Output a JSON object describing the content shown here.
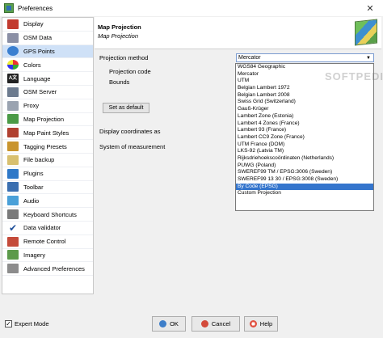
{
  "window": {
    "title": "Preferences",
    "close_glyph": "✕"
  },
  "sidebar": {
    "items": [
      {
        "label": "Display",
        "icon": "display-icon"
      },
      {
        "label": "OSM Data",
        "icon": "osm-data-icon"
      },
      {
        "label": "GPS Points",
        "icon": "gps-points-icon",
        "selected": true
      },
      {
        "label": "Colors",
        "icon": "colors-icon"
      },
      {
        "label": "Language",
        "icon": "language-icon"
      },
      {
        "label": "OSM Server",
        "icon": "osm-server-icon"
      },
      {
        "label": "Proxy",
        "icon": "proxy-icon"
      },
      {
        "label": "Map Projection",
        "icon": "map-projection-icon"
      },
      {
        "label": "Map Paint Styles",
        "icon": "paint-styles-icon"
      },
      {
        "label": "Tagging Presets",
        "icon": "tagging-presets-icon"
      },
      {
        "label": "File backup",
        "icon": "file-backup-icon"
      },
      {
        "label": "Plugins",
        "icon": "plugins-icon"
      },
      {
        "label": "Toolbar",
        "icon": "toolbar-icon"
      },
      {
        "label": "Audio",
        "icon": "audio-icon"
      },
      {
        "label": "Keyboard Shortcuts",
        "icon": "keyboard-icon"
      },
      {
        "label": "Data validator",
        "icon": "validator-check-icon"
      },
      {
        "label": "Remote Control",
        "icon": "remote-control-icon"
      },
      {
        "label": "Imagery",
        "icon": "imagery-icon"
      },
      {
        "label": "Advanced Preferences",
        "icon": "advanced-preferences-icon"
      }
    ]
  },
  "panel": {
    "title": "Map Projection",
    "subtitle": "Map Projection",
    "projection_method_label": "Projection method",
    "projection_code_label": "Projection code",
    "bounds_label": "Bounds",
    "set_default_label": "Set as default",
    "coords_label": "Display coordinates as",
    "measurement_label": "System of measurement",
    "combo_value": "Mercator",
    "watermark": "SOFTPEDIA",
    "dropdown_options": [
      "WGS84 Geographic",
      "Mercator",
      "UTM",
      "Belgian Lambert 1972",
      "Belgian Lambert 2008",
      "Swiss Grid (Switzerland)",
      "Gauß-Krüger",
      "Lambert Zone (Estonia)",
      "Lambert 4 Zones (France)",
      "Lambert 93 (France)",
      "Lambert CC9 Zone (France)",
      "UTM France (DOM)",
      "LKS-92 (Latvia TM)",
      "Rijksdriehoekscoördinaten (Netherlands)",
      "PUWG (Poland)",
      "SWEREF99 TM / EPSG:3006 (Sweden)",
      "SWEREF99 13 30 / EPSG:3008 (Sweden)",
      "By Code (EPSG)",
      "Custom Projection"
    ],
    "dropdown_selected_index": 17
  },
  "footer": {
    "expert_mode_label": "Expert Mode",
    "expert_mode_checked": true,
    "ok_label": "OK",
    "cancel_label": "Cancel",
    "help_label": "Help"
  },
  "colors": {
    "selection": "#3475cd",
    "sidebar_selected": "#cfe1f7"
  }
}
